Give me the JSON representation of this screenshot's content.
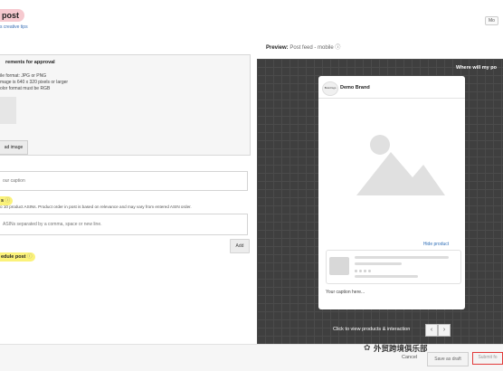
{
  "header": {
    "title": "post",
    "subtitle": "s creative tips",
    "top_right": "Mo"
  },
  "requirements": {
    "title": "rements for approval",
    "lines": [
      "ile format: JPG or PNG",
      "mage is 640 x 320 pixels or larger",
      "olor format must be RGB"
    ],
    "upload_label": "ad image"
  },
  "caption": {
    "label": "",
    "placeholder": "our caption"
  },
  "products": {
    "label": "s",
    "help": "o 10 product ASINs. Product order in post is based on relevance and may vary from entered ASIN order.",
    "placeholder": "ASINs separated by a comma, space or new line.",
    "add_label": "Add"
  },
  "schedule": {
    "label": "edule post"
  },
  "preview": {
    "label": "Preview:",
    "sublabel": "Post feed - mobile",
    "where": "Where will my po",
    "brand_logo_text": "Brand logo",
    "brand_name": "Demo Brand",
    "hide_product": "Hide product",
    "caption": "Your caption here...",
    "click_to_view": "Click to view products & interaction"
  },
  "footer": {
    "watermark": "外贸跨境俱乐部",
    "cancel": "Cancel",
    "save_draft": "Save as draft",
    "submit": "Submit fo"
  },
  "colors": {
    "highlight_yellow": "#fbf27a",
    "title_pink": "#f6c9cf",
    "link_blue": "#2e6eb7",
    "submit_border": "#e23a3a",
    "stage_bg": "#3f3f3f"
  }
}
